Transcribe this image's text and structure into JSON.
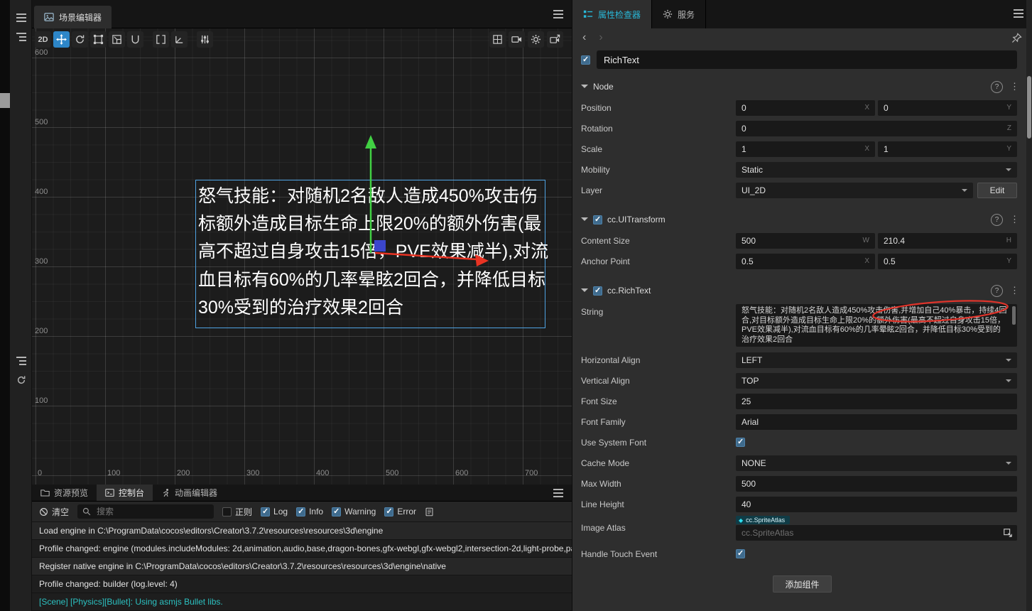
{
  "scene": {
    "tab_label": "场景编辑器",
    "tools": {
      "mode_2d": "2D"
    },
    "ruler_left": [
      "600",
      "500",
      "400",
      "300",
      "200",
      "100"
    ],
    "ruler_bottom": [
      "0",
      "100",
      "200",
      "300",
      "400",
      "500",
      "600",
      "700"
    ],
    "richtext_node": {
      "lines": [
        "怒气技能：对随机2名敌人造成450%攻击伤",
        "标额外造成目标生命上限20%的额外伤害(最",
        "高不超过自身攻击15倍，PVE效果减半),对流",
        "血目标有60%的几率晕眩2回合，并降低目标",
        "30%受到的治疗效果2回合"
      ]
    }
  },
  "console": {
    "tabs": [
      {
        "label": "资源预览"
      },
      {
        "label": "控制台"
      },
      {
        "label": "动画编辑器"
      }
    ],
    "clear_label": "清空",
    "search_placeholder": "搜索",
    "regex_label": "正则",
    "filters": [
      {
        "label": "Log",
        "checked": true
      },
      {
        "label": "Info",
        "checked": true
      },
      {
        "label": "Warning",
        "checked": true
      },
      {
        "label": "Error",
        "checked": true
      }
    ],
    "logs": [
      {
        "text": "Load engine in C:\\ProgramData\\cocos\\editors\\Creator\\3.7.2\\resources\\resources\\3d\\engine",
        "type": "info"
      },
      {
        "text": "Profile changed: engine (modules.includeModules: 2d,animation,audio,base,dragon-bones,gfx-webgl,gfx-webgl2,intersection-2d,light-probe,pa",
        "type": "info"
      },
      {
        "text": "Register native engine in C:\\ProgramData\\cocos\\editors\\Creator\\3.7.2\\resources\\resources\\3d\\engine\\native",
        "type": "info"
      },
      {
        "text": "Profile changed: builder (log.level: 4)",
        "type": "info"
      },
      {
        "text": "[Scene] [Physics][Bullet]: Using asmjs Bullet libs.",
        "type": "scene"
      }
    ]
  },
  "inspector": {
    "tabs": [
      {
        "label": "属性检查器"
      },
      {
        "label": "服务"
      }
    ],
    "node_name": "RichText",
    "suffix": {
      "x": "X",
      "y": "Y",
      "z": "Z",
      "w": "W",
      "h": "H"
    },
    "node_section": {
      "title": "Node",
      "position": {
        "label": "Position",
        "x": "0",
        "y": "0"
      },
      "rotation": {
        "label": "Rotation",
        "z": "0"
      },
      "scale": {
        "label": "Scale",
        "x": "1",
        "y": "1"
      },
      "mobility": {
        "label": "Mobility",
        "value": "Static"
      },
      "layer": {
        "label": "Layer",
        "value": "UI_2D",
        "edit_label": "Edit"
      }
    },
    "uitransform_section": {
      "title": "cc.UITransform",
      "content_size": {
        "label": "Content Size",
        "w": "500",
        "h": "210.4"
      },
      "anchor_point": {
        "label": "Anchor Point",
        "x": "0.5",
        "y": "0.5"
      }
    },
    "richtext_section": {
      "title": "cc.RichText",
      "string": {
        "label": "String",
        "value": "怒气技能：对随机2名敌人造成450%攻击伤害,并增加自己40%暴击，持续4回合,对目标额外造成目标生命上限20%的额外伤害(最高不超过自身攻击15倍，PVE效果减半),对流血目标有60%的几率晕眩2回合，并降低目标30%受到的治疗效果2回合"
      },
      "horizontal_align": {
        "label": "Horizontal Align",
        "value": "LEFT"
      },
      "vertical_align": {
        "label": "Vertical Align",
        "value": "TOP"
      },
      "font_size": {
        "label": "Font Size",
        "value": "25"
      },
      "font_family": {
        "label": "Font Family",
        "value": "Arial"
      },
      "use_system_font": {
        "label": "Use System Font",
        "checked": true
      },
      "cache_mode": {
        "label": "Cache Mode",
        "value": "NONE"
      },
      "max_width": {
        "label": "Max Width",
        "value": "500"
      },
      "line_height": {
        "label": "Line Height",
        "value": "40"
      },
      "image_atlas": {
        "label": "Image Atlas",
        "type_badge": "cc.SpriteAtlas",
        "placeholder": "cc.SpriteAtlas"
      },
      "handle_touch_event": {
        "label": "Handle Touch Event",
        "checked": true
      }
    },
    "add_component_label": "添加组件"
  },
  "colors": {
    "accent_cyan": "#29b8d8",
    "annotation_red": "#e0342b",
    "log_scene_teal": "#2cc1c1",
    "gizmo_green": "#41d043",
    "gizmo_red": "#e93323",
    "gizmo_blue": "#3b46cc",
    "selection_blue": "#4fa3e3"
  }
}
